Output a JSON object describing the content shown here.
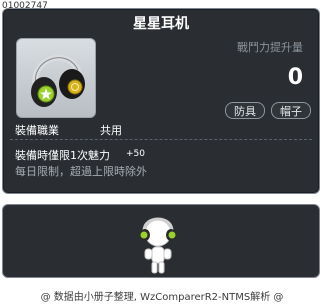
{
  "item": {
    "id": "01002747",
    "name": "星星耳机",
    "stat_label": "戰鬥力提升量",
    "stat_value": "0",
    "category_tag": "防具",
    "subcategory_tag": "帽子",
    "job_label": "裝備職業",
    "job_value": "共用",
    "requirement_label": "裝備時僅限1次魅力",
    "requirement_value": "+50",
    "limit_text": "每日限制，超過上限時除外",
    "icon": "headphones-icon"
  },
  "footer": {
    "credit": "@ 数据由小册子整理, WzComparerR2-NTMS解析 @"
  },
  "colors": {
    "tooltip_bg": "#2a2e33",
    "border": "#7c8590",
    "headphone_accent": "#9ad12a"
  }
}
